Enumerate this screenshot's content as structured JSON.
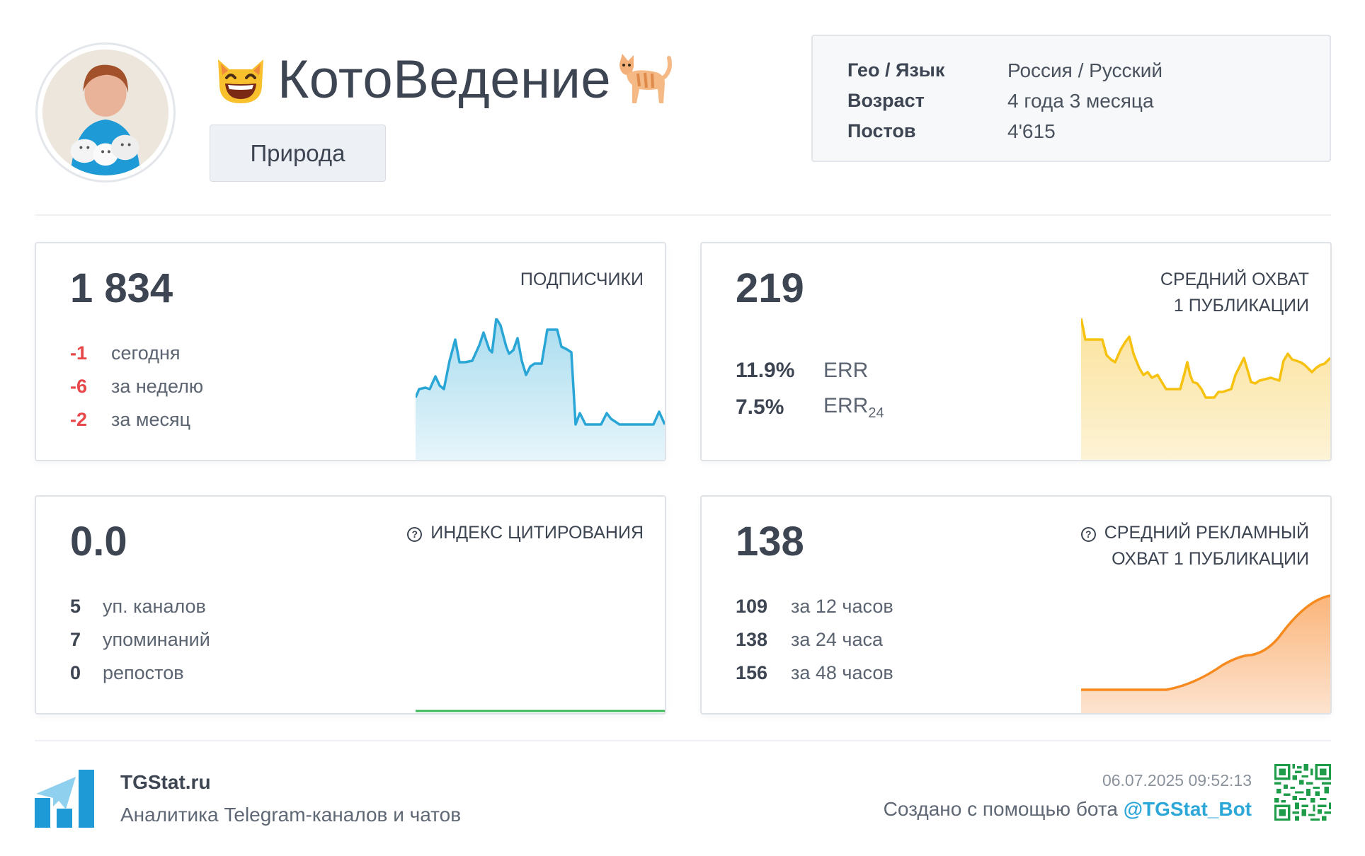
{
  "channel": {
    "title": "КотоВедение",
    "category": "Природа",
    "avatar_alt": "avatar"
  },
  "info": [
    {
      "key": "Гео / Язык",
      "value": "Россия / Русский"
    },
    {
      "key": "Возраст",
      "value": "4 года 3 месяца"
    },
    {
      "key": "Постов",
      "value": "4'615"
    }
  ],
  "subscribers": {
    "value": "1 834",
    "label": "ПОДПИСЧИКИ",
    "rows": [
      {
        "n": "-1",
        "t": "сегодня"
      },
      {
        "n": "-6",
        "t": "за неделю"
      },
      {
        "n": "-2",
        "t": "за месяц"
      }
    ]
  },
  "reach": {
    "value": "219",
    "label_line1": "СРЕДНИЙ ОХВАТ",
    "label_line2": "1 ПУБЛИКАЦИИ",
    "rows": [
      {
        "n": "11.9%",
        "t": "ERR",
        "sub": ""
      },
      {
        "n": "7.5%",
        "t": "ERR",
        "sub": "24"
      }
    ]
  },
  "citation": {
    "value": "0.0",
    "label": "ИНДЕКС ЦИТИРОВАНИЯ",
    "rows": [
      {
        "n": "5",
        "t": "уп. каналов"
      },
      {
        "n": "7",
        "t": "упоминаний"
      },
      {
        "n": "0",
        "t": "репостов"
      }
    ]
  },
  "ad_reach": {
    "value": "138",
    "label_line1": "СРЕДНИЙ РЕКЛАМНЫЙ",
    "label_line2": "ОХВАТ 1 ПУБЛИКАЦИИ",
    "rows": [
      {
        "n": "109",
        "t": "за 12 часов"
      },
      {
        "n": "138",
        "t": "за 24 часа"
      },
      {
        "n": "156",
        "t": "за 48 часов"
      }
    ]
  },
  "footer": {
    "brand": "TGStat.ru",
    "tagline": "Аналитика Telegram-каналов и чатов",
    "timestamp": "06.07.2025 09:52:13",
    "created_prefix": "Создано с помощью бота ",
    "bot": "@TGStat_Bot"
  },
  "colors": {
    "subscribers_line": "#2aa6d6",
    "reach_line": "#f6c10f",
    "citation_line": "#3cb85c",
    "ad_line": "#f68a1e",
    "negative": "#e8474a",
    "link": "#2da7d8"
  },
  "icons": [
    "cat-face-icon",
    "cat-icon",
    "question-icon",
    "tgstat-logo-icon",
    "qr-code-icon"
  ]
}
